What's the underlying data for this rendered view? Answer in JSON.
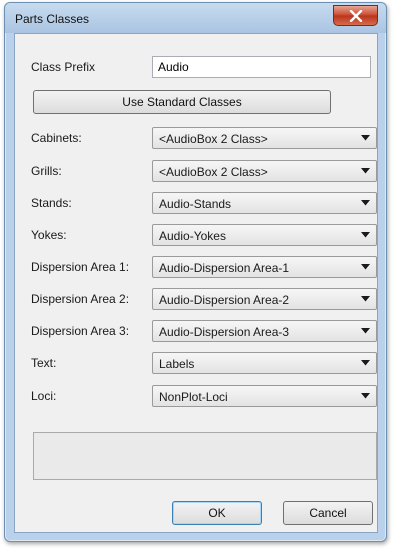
{
  "window": {
    "title": "Parts Classes",
    "close_label": "X"
  },
  "class_prefix": {
    "label": "Class Prefix",
    "value": "Audio"
  },
  "use_standard_button": "Use Standard Classes",
  "rows": [
    {
      "label": "Cabinets:",
      "value": "<AudioBox 2 Class>"
    },
    {
      "label": "Grills:",
      "value": "<AudioBox 2 Class>"
    },
    {
      "label": "Stands:",
      "value": "Audio-Stands"
    },
    {
      "label": "Yokes:",
      "value": "Audio-Yokes"
    },
    {
      "label": "Dispersion Area 1:",
      "value": "Audio-Dispersion Area-1"
    },
    {
      "label": "Dispersion Area 2:",
      "value": "Audio-Dispersion Area-2"
    },
    {
      "label": "Dispersion Area 3:",
      "value": "Audio-Dispersion Area-3"
    },
    {
      "label": "Text:",
      "value": "Labels"
    },
    {
      "label": "Loci:",
      "value": "NonPlot-Loci"
    }
  ],
  "buttons": {
    "ok": "OK",
    "cancel": "Cancel"
  },
  "icons": {
    "close": "close-icon",
    "dropdown": "chevron-down-icon"
  },
  "colors": {
    "close_button": "#c9462c",
    "window_frame": "#b9d1ea",
    "client_bg": "#f0f0f0"
  }
}
